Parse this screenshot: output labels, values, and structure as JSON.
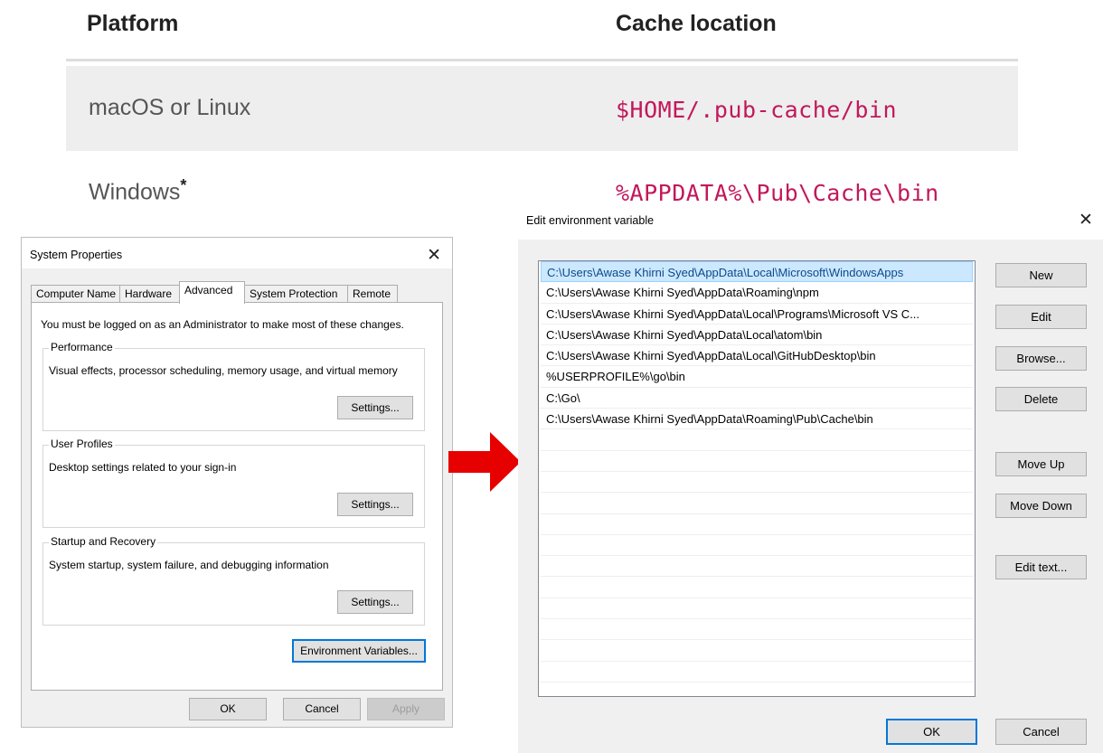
{
  "doc_table": {
    "headers": [
      "Platform",
      "Cache location"
    ],
    "rows": [
      {
        "platform": "macOS or Linux",
        "cache": "$HOME/.pub-cache/bin"
      },
      {
        "platform": "Windows",
        "platform_mark": "*",
        "cache": "%APPDATA%\\Pub\\Cache\\bin"
      }
    ],
    "accent_color": "#c2185b"
  },
  "system_properties": {
    "title": "System Properties",
    "close_icon": "close-icon",
    "tabs": [
      "Computer Name",
      "Hardware",
      "Advanced",
      "System Protection",
      "Remote"
    ],
    "active_tab": "Advanced",
    "admin_note": "You must be logged on as an Administrator to make most of these changes.",
    "groups": [
      {
        "legend": "Performance",
        "desc": "Visual effects, processor scheduling, memory usage, and virtual memory",
        "button": "Settings..."
      },
      {
        "legend": "User Profiles",
        "desc": "Desktop settings related to your sign-in",
        "button": "Settings..."
      },
      {
        "legend": "Startup and Recovery",
        "desc": "System startup, system failure, and debugging information",
        "button": "Settings..."
      }
    ],
    "env_vars_button": "Environment Variables...",
    "ok": "OK",
    "cancel": "Cancel",
    "apply": "Apply"
  },
  "arrow": {
    "icon": "right-arrow-icon",
    "color": "#e60000"
  },
  "edit_env": {
    "title": "Edit environment variable",
    "close_icon": "close-icon",
    "entries": [
      "C:\\Users\\Awase Khirni Syed\\AppData\\Local\\Microsoft\\WindowsApps",
      "C:\\Users\\Awase Khirni Syed\\AppData\\Roaming\\npm",
      "C:\\Users\\Awase Khirni Syed\\AppData\\Local\\Programs\\Microsoft VS C...",
      "C:\\Users\\Awase Khirni Syed\\AppData\\Local\\atom\\bin",
      "C:\\Users\\Awase Khirni Syed\\AppData\\Local\\GitHubDesktop\\bin",
      "%USERPROFILE%\\go\\bin",
      "C:\\Go\\",
      "C:\\Users\\Awase Khirni Syed\\AppData\\Roaming\\Pub\\Cache\\bin"
    ],
    "selected_index": 0,
    "buttons": {
      "new": "New",
      "edit": "Edit",
      "browse": "Browse...",
      "delete": "Delete",
      "move_up": "Move Up",
      "move_down": "Move Down",
      "edit_text": "Edit text..."
    },
    "ok": "OK",
    "cancel": "Cancel"
  }
}
